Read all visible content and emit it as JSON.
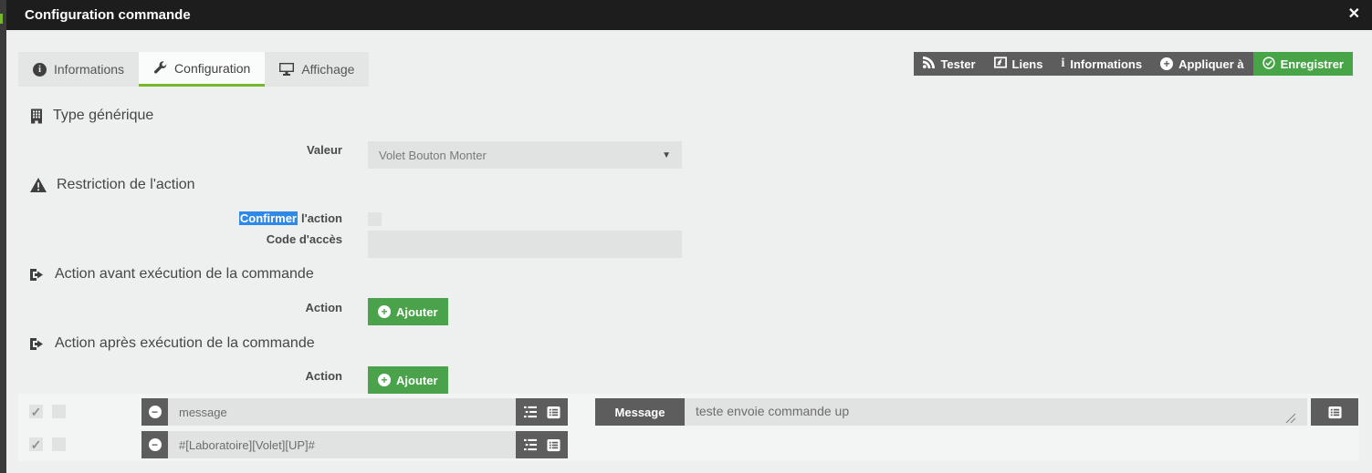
{
  "window": {
    "title": "Configuration commande"
  },
  "icons": {
    "close": "✕",
    "check": "✓",
    "caret_down": "▼",
    "plus": "+",
    "minus": "−",
    "info_letter": "i"
  },
  "tabs": [
    {
      "label": "Informations",
      "icon": "info-circle-icon",
      "active": false
    },
    {
      "label": "Configuration",
      "icon": "wrench-icon",
      "active": true
    },
    {
      "label": "Affichage",
      "icon": "monitor-icon",
      "active": false
    }
  ],
  "toolbar": [
    {
      "label": "Tester",
      "icon": "rss-icon"
    },
    {
      "label": "Liens",
      "icon": "frame-link-icon"
    },
    {
      "label": "Informations",
      "icon": "info-icon"
    },
    {
      "label": "Appliquer à",
      "icon": "plus-circle-icon"
    },
    {
      "label": "Enregistrer",
      "icon": "check-circle-icon"
    }
  ],
  "sections": {
    "type_generique": {
      "title": "Type générique",
      "valeur_label": "Valeur",
      "valeur_value": "Volet Bouton Monter"
    },
    "restriction": {
      "title": "Restriction de l'action",
      "confirm_selected": "Confirmer",
      "confirm_rest": "l'action",
      "confirm_checked": false,
      "code_label": "Code d'accès",
      "code_value": ""
    },
    "action_avant": {
      "title": "Action avant exécution de la commande",
      "action_label": "Action",
      "add_label": "Ajouter"
    },
    "action_apres": {
      "title": "Action après exécution de la commande",
      "action_label": "Action",
      "add_label": "Ajouter"
    }
  },
  "rows": [
    {
      "enabled": true,
      "option_checked": false,
      "command": "message",
      "type_label": "Message",
      "value": "teste envoie commande up"
    },
    {
      "enabled": true,
      "option_checked": false,
      "command": "#[Laboratoire][Volet][UP]#"
    }
  ],
  "colors": {
    "titlebar": "#1d1d1d",
    "page_bg": "#eef0f0",
    "dark_button": "#5d5d5d",
    "green_button": "#47a447",
    "tab_underline": "#76b82a",
    "selection_blue": "#2f89e9",
    "input_bg": "#e1e2e2"
  }
}
